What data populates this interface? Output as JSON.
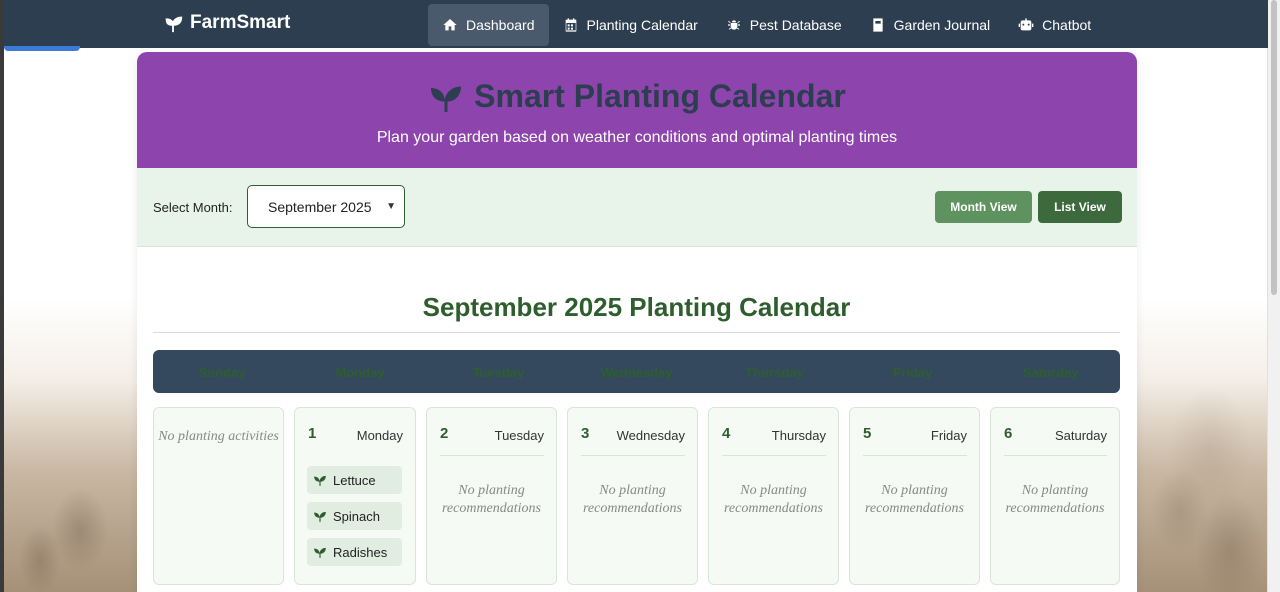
{
  "brand": {
    "name": "FarmSmart"
  },
  "nav": [
    {
      "label": "Dashboard",
      "icon": "home-icon",
      "active": true
    },
    {
      "label": "Planting Calendar",
      "icon": "calendar-icon",
      "active": false
    },
    {
      "label": "Pest Database",
      "icon": "bug-icon",
      "active": false
    },
    {
      "label": "Garden Journal",
      "icon": "journal-icon",
      "active": false
    },
    {
      "label": "Chatbot",
      "icon": "robot-icon",
      "active": false
    }
  ],
  "hero": {
    "title": "Smart Planting Calendar",
    "subtitle": "Plan your garden based on weather conditions and optimal planting times"
  },
  "controls": {
    "select_label": "Select Month:",
    "selected_month": "September 2025",
    "month_view_label": "Month View",
    "list_view_label": "List View"
  },
  "calendar": {
    "title": "September 2025 Planting Calendar",
    "weekdays": [
      "Sunday",
      "Monday",
      "Tuesday",
      "Wednesday",
      "Thursday",
      "Friday",
      "Saturday"
    ],
    "days": [
      {
        "number": "",
        "weekday": "",
        "empty_text": "No planting activities",
        "crops": []
      },
      {
        "number": "1",
        "weekday": "Monday",
        "empty_text": "",
        "crops": [
          "Lettuce",
          "Spinach",
          "Radishes"
        ]
      },
      {
        "number": "2",
        "weekday": "Tuesday",
        "empty_text": "No planting recommendations",
        "crops": []
      },
      {
        "number": "3",
        "weekday": "Wednesday",
        "empty_text": "No planting recommendations",
        "crops": []
      },
      {
        "number": "4",
        "weekday": "Thursday",
        "empty_text": "No planting recommendations",
        "crops": []
      },
      {
        "number": "5",
        "weekday": "Friday",
        "empty_text": "No planting recommendations",
        "crops": []
      },
      {
        "number": "6",
        "weekday": "Saturday",
        "empty_text": "No planting recommendations",
        "crops": []
      }
    ]
  },
  "colors": {
    "navbar": "#2c3e50",
    "hero": "#8e44ad",
    "accent_green": "#2e5e2e",
    "controls_bg": "#e8f3ea"
  }
}
